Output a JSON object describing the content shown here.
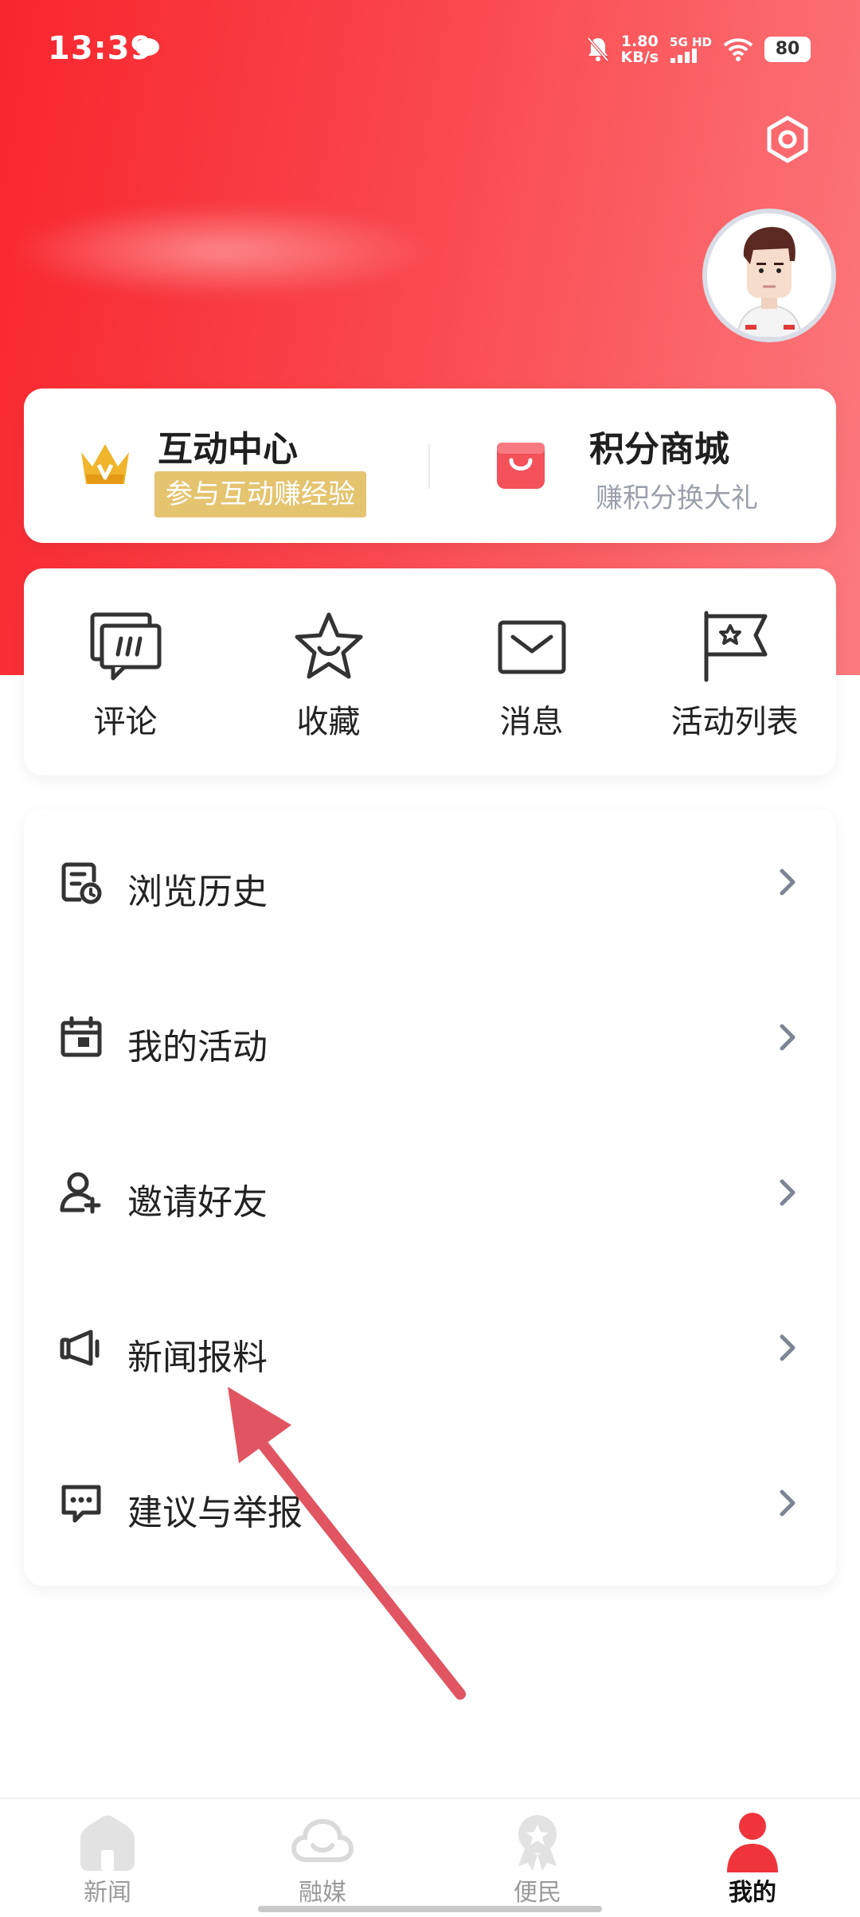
{
  "status_bar": {
    "time": "13:39",
    "speed_value": "1.80",
    "speed_unit": "KB/s",
    "network": "5G HD",
    "battery": "80"
  },
  "colors": {
    "primary": "#f8262d",
    "badge_gold": "#e5c470",
    "arrow": "#e05561"
  },
  "top_card": {
    "interaction_center": {
      "title": "互动中心",
      "badge": "参与互动赚经验",
      "icon": "crown-icon"
    },
    "points_store": {
      "title": "积分商城",
      "subtitle": "赚积分换大礼",
      "icon": "gift-bag-icon"
    }
  },
  "quick_actions": [
    {
      "label": "评论",
      "icon": "comment-icon"
    },
    {
      "label": "收藏",
      "icon": "star-icon"
    },
    {
      "label": "消息",
      "icon": "envelope-icon"
    },
    {
      "label": "活动列表",
      "icon": "flag-icon"
    }
  ],
  "menu": [
    {
      "label": "浏览历史",
      "icon": "history-icon"
    },
    {
      "label": "我的活动",
      "icon": "calendar-icon"
    },
    {
      "label": "邀请好友",
      "icon": "add-user-icon"
    },
    {
      "label": "新闻报料",
      "icon": "megaphone-icon"
    },
    {
      "label": "建议与举报",
      "icon": "feedback-icon"
    }
  ],
  "bottom_nav": [
    {
      "label": "新闻",
      "icon": "home-icon",
      "active": false
    },
    {
      "label": "融媒",
      "icon": "cloud-icon",
      "active": false
    },
    {
      "label": "便民",
      "icon": "badge-icon",
      "active": false
    },
    {
      "label": "我的",
      "icon": "user-icon",
      "active": true
    }
  ]
}
